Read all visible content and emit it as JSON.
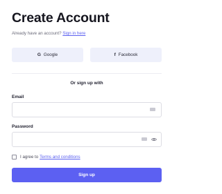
{
  "header": {
    "title": "Create Account",
    "signin_prompt": "Already have an account?",
    "signin_link": "Sign in here"
  },
  "social": {
    "google_icon": "G",
    "google_label": "Google",
    "facebook_icon": "f",
    "facebook_label": "Facebook"
  },
  "divider_text": "Or sign up with",
  "form": {
    "email_label": "Email",
    "email_value": "",
    "password_label": "Password",
    "password_value": "",
    "terms_prefix": "I agree to",
    "terms_link": "Terms and conditions",
    "terms_checked": false,
    "submit_label": "Sign up"
  },
  "colors": {
    "accent": "#5c60f2",
    "link": "#5a5ff0",
    "social_bg": "#eef0fb"
  },
  "icons": {
    "field_autofill": "keyboard-icon",
    "password_toggle": "eye-icon"
  }
}
